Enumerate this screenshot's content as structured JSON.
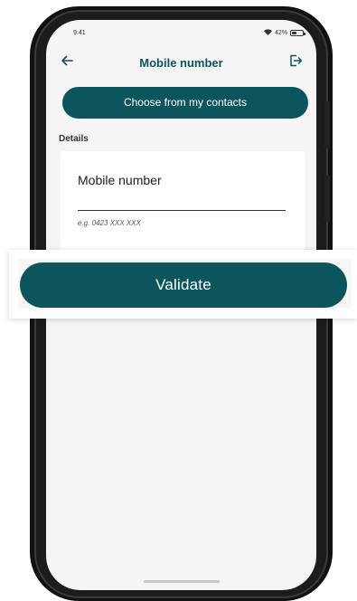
{
  "status_bar": {
    "time": "9:41",
    "battery": "42%",
    "battery_level": 0.42
  },
  "header": {
    "title": "Mobile number",
    "back_icon": "arrow-left-icon",
    "logout_icon": "logout-icon"
  },
  "contacts_button": {
    "label": "Choose from my contacts"
  },
  "details": {
    "section_label": "Details",
    "field_label": "Mobile number",
    "field_value": "",
    "field_hint": "e.g. 0423 XXX XXX"
  },
  "validate": {
    "label": "Validate"
  },
  "colors": {
    "accent": "#0d555c",
    "background": "#f5f5f5",
    "card": "#ffffff"
  }
}
